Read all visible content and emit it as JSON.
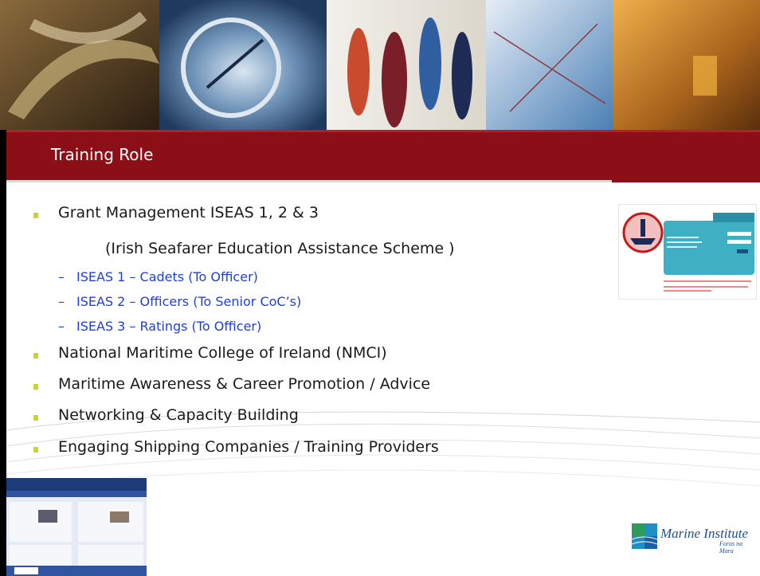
{
  "slide": {
    "title": "Training Role"
  },
  "bullets": [
    {
      "text": "Grant Management ISEAS 1, 2 & 3"
    },
    {
      "text": "(Irish Seafarer Education Assistance Scheme )"
    },
    {
      "text": "ISEAS 1 – Cadets (To Officer)"
    },
    {
      "text": "ISEAS 2 – Officers (To Senior CoC’s)"
    },
    {
      "text": "ISEAS 3 – Ratings (To Officer)"
    },
    {
      "text": "National Maritime College of Ireland (NMCI)"
    },
    {
      "text": "Maritime Awareness & Career Promotion / Advice"
    },
    {
      "text": "Networking & Capacity Building"
    },
    {
      "text": "Engaging Shipping Companies / Training Providers"
    }
  ],
  "logo": {
    "name": "Marine Institute",
    "tagline": "Foras na Mara"
  },
  "colors": {
    "title_bar": "#8c0f17",
    "bullet": "#c9d23a",
    "sub_item": "#1f3fd6"
  }
}
